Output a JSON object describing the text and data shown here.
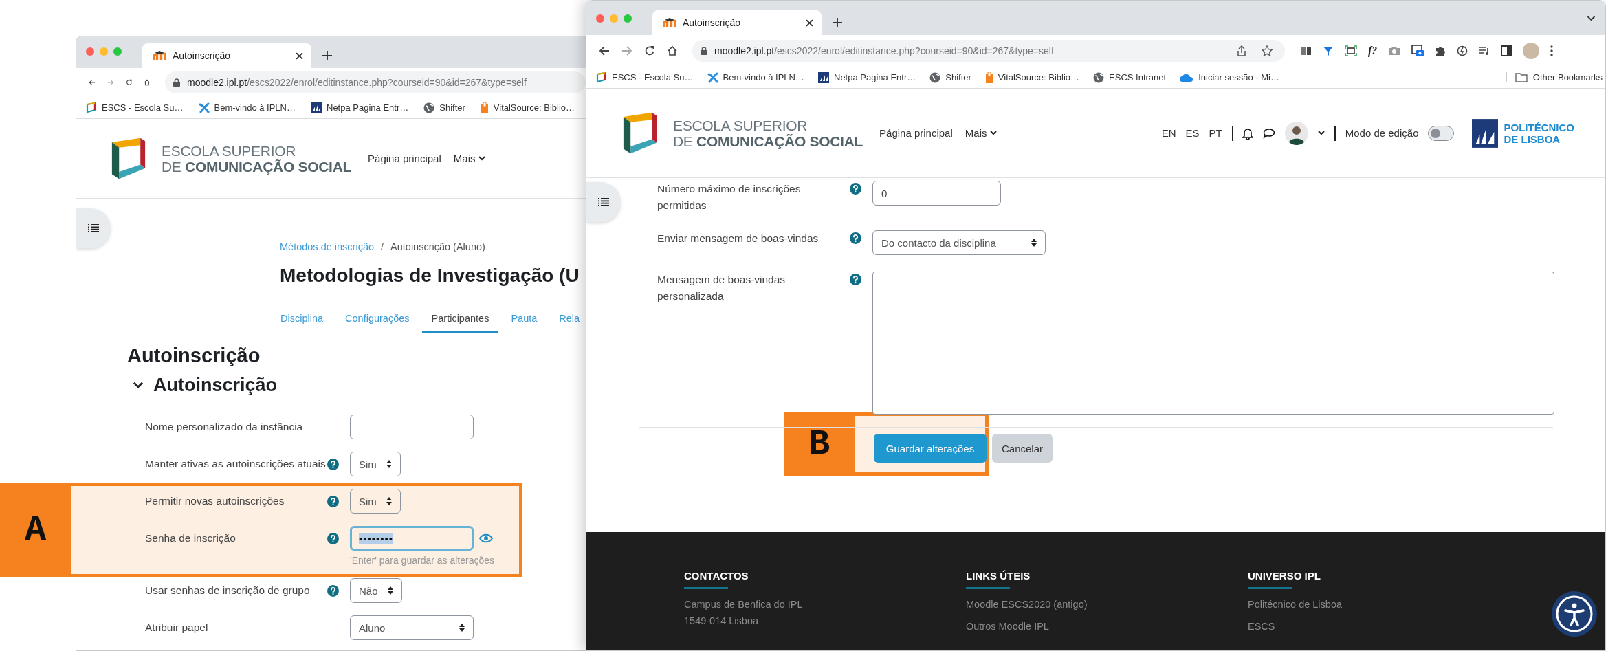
{
  "left_window": {
    "tab_title": "Autoinscrição",
    "url_host": "moodle2.ipl.pt",
    "url_path": "/escs2022/enrol/editinstance.php?courseid=90&id=267&type=self",
    "bookmarks": [
      {
        "kind": "escs",
        "label": "ESCS - Escola Su…"
      },
      {
        "kind": "cross",
        "label": "Bem-vindo à IPLN…"
      },
      {
        "kind": "netpa",
        "label": "Netpa Pagina Entr…"
      },
      {
        "kind": "globe",
        "label": "Shifter"
      },
      {
        "kind": "tag",
        "label": "VitalSource: Biblio…"
      }
    ],
    "logo_top": "ESCOLA SUPERIOR",
    "logo_bottom": "DE **COMUNICAÇÃO SOCIAL**",
    "site_nav": [
      "Página principal"
    ],
    "more": "Mais",
    "breadcrumb_link": "Métodos de inscrição",
    "breadcrumb_separator": "/",
    "breadcrumb_current": "Autoinscrição (Aluno)",
    "course_title": "Metodologias de Investigação (U",
    "course_tabs": [
      {
        "label": "Disciplina",
        "selected": false
      },
      {
        "label": "Configurações",
        "selected": false
      },
      {
        "label": "Participantes",
        "selected": true
      },
      {
        "label": "Pauta",
        "selected": false
      },
      {
        "label": "Rela",
        "selected": false
      }
    ],
    "page_heading": "Autoinscrição",
    "section_heading": "Autoinscrição",
    "section_expanded": true,
    "form": [
      {
        "kind": "text",
        "label": "Nome personalizado da instância",
        "help": false
      },
      {
        "kind": "select",
        "label": "Manter ativas as autoinscrições atuais",
        "help": true,
        "value": "Sim"
      },
      {
        "kind": "select",
        "label": "Permitir novas autoinscrições",
        "help": true,
        "value": "Sim"
      },
      {
        "kind": "password",
        "label": "Senha de inscrição",
        "help": true,
        "value": "••••••••",
        "focused": true,
        "hint": "'Enter' para guardar as alterações"
      },
      {
        "kind": "select",
        "label": "Usar senhas de inscrição de grupo",
        "help": true,
        "value": "Não"
      },
      {
        "kind": "wide-select",
        "label": "Atribuir papel",
        "help": false,
        "value": "Aluno"
      }
    ]
  },
  "right_window": {
    "tab_title": "Autoinscrição",
    "url_host": "moodle2.ipl.pt",
    "url_path": "/escs2022/enrol/editinstance.php?courseid=90&id=267&type=self",
    "formula_extension": "f?",
    "bookmarks": [
      {
        "kind": "escs",
        "label": "ESCS - Escola Su…"
      },
      {
        "kind": "cross",
        "label": "Bem-vindo à IPLN…"
      },
      {
        "kind": "netpa",
        "label": "Netpa Pagina Entr…"
      },
      {
        "kind": "globe",
        "label": "Shifter"
      },
      {
        "kind": "tag",
        "label": "VitalSource: Biblio…"
      },
      {
        "kind": "globe",
        "label": "ESCS Intranet"
      },
      {
        "kind": "cloud",
        "label": "Iniciar sessão - Mi…"
      }
    ],
    "other_bookmarks": "Other Bookmarks",
    "logo_top": "ESCOLA SUPERIOR",
    "logo_bottom": "DE **COMUNICAÇÃO SOCIAL**",
    "site_nav": [
      "Página principal"
    ],
    "more": "Mais",
    "languages": [
      "EN",
      "ES",
      "PT"
    ],
    "edit_mode_label": "Modo de edição",
    "edit_mode_on": false,
    "brand_top": "POLITÉCNICO",
    "brand_bottom": "DE LISBOA",
    "form": [
      {
        "kind": "text",
        "label": "Número máximo de inscrições permitidas",
        "help": true,
        "value": "0"
      },
      {
        "kind": "wide-select",
        "label": "Enviar mensagem de boas-vindas",
        "help": true,
        "value": "Do contacto da disciplina"
      },
      {
        "kind": "textarea",
        "label": "Mensagem de boas-vindas personalizada",
        "help": true
      }
    ],
    "buttons": [
      {
        "kind": "primary",
        "label": "Guardar alterações"
      },
      {
        "kind": "secondary",
        "label": "Cancelar"
      }
    ],
    "footer": [
      {
        "kind": "address",
        "heading": "CONTACTOS",
        "lines": [
          "Campus de Benfica do IPL",
          "1549-014 Lisboa"
        ]
      },
      {
        "kind": "links",
        "heading": "LINKS ÚTEIS",
        "lines": [
          "Moodle ESCS2020 (antigo)",
          "Outros Moodle IPL"
        ]
      },
      {
        "kind": "links",
        "heading": "UNIVERSO IPL",
        "lines": [
          "Politécnico de Lisboa",
          "ESCS"
        ]
      }
    ]
  },
  "annotations": [
    {
      "label": "A"
    },
    {
      "label": "B"
    }
  ]
}
